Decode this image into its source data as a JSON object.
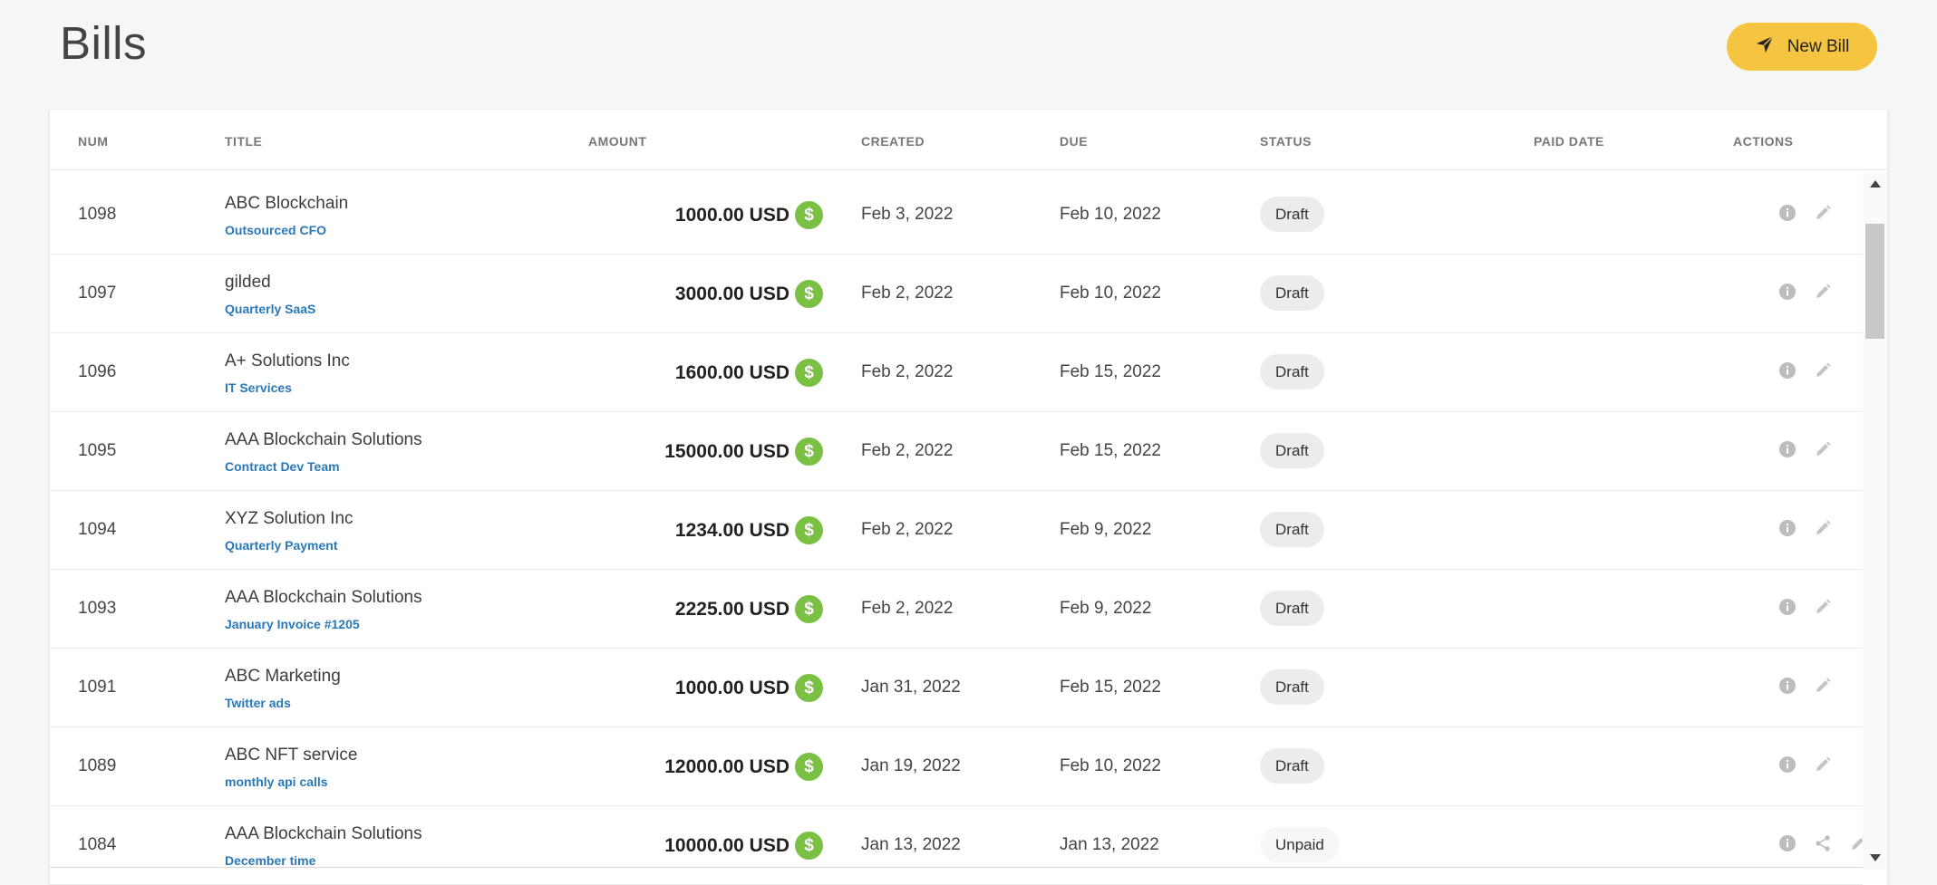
{
  "header": {
    "title": "Bills",
    "new_bill_label": "New Bill"
  },
  "table": {
    "columns": {
      "num": "NUM",
      "title": "TITLE",
      "amount": "AMOUNT",
      "created": "CREATED",
      "due": "DUE",
      "status": "STATUS",
      "paid_date": "PAID DATE",
      "actions": "ACTIONS"
    },
    "rows": [
      {
        "num": "1098",
        "title": "ABC Blockchain",
        "subtitle": "Outsourced CFO",
        "amount": "1000.00 USD",
        "created": "Feb 3, 2022",
        "due": "Feb 10, 2022",
        "status": "Draft",
        "paid_date": ""
      },
      {
        "num": "1097",
        "title": "gilded",
        "subtitle": "Quarterly SaaS",
        "amount": "3000.00 USD",
        "created": "Feb 2, 2022",
        "due": "Feb 10, 2022",
        "status": "Draft",
        "paid_date": ""
      },
      {
        "num": "1096",
        "title": "A+ Solutions Inc",
        "subtitle": "IT Services",
        "amount": "1600.00 USD",
        "created": "Feb 2, 2022",
        "due": "Feb 15, 2022",
        "status": "Draft",
        "paid_date": ""
      },
      {
        "num": "1095",
        "title": "AAA Blockchain Solutions",
        "subtitle": "Contract Dev Team",
        "amount": "15000.00 USD",
        "created": "Feb 2, 2022",
        "due": "Feb 15, 2022",
        "status": "Draft",
        "paid_date": ""
      },
      {
        "num": "1094",
        "title": "XYZ Solution Inc",
        "subtitle": "Quarterly Payment",
        "amount": "1234.00 USD",
        "created": "Feb 2, 2022",
        "due": "Feb 9, 2022",
        "status": "Draft",
        "paid_date": ""
      },
      {
        "num": "1093",
        "title": "AAA Blockchain Solutions",
        "subtitle": "January Invoice #1205",
        "amount": "2225.00 USD",
        "created": "Feb 2, 2022",
        "due": "Feb 9, 2022",
        "status": "Draft",
        "paid_date": ""
      },
      {
        "num": "1091",
        "title": "ABC Marketing",
        "subtitle": "Twitter ads",
        "amount": "1000.00 USD",
        "created": "Jan 31, 2022",
        "due": "Feb 15, 2022",
        "status": "Draft",
        "paid_date": ""
      },
      {
        "num": "1089",
        "title": "ABC NFT service",
        "subtitle": "monthly api calls",
        "amount": "12000.00 USD",
        "created": "Jan 19, 2022",
        "due": "Feb 10, 2022",
        "status": "Draft",
        "paid_date": ""
      },
      {
        "num": "1084",
        "title": "AAA Blockchain Solutions",
        "subtitle": "December time",
        "amount": "10000.00 USD",
        "created": "Jan 13, 2022",
        "due": "Jan 13, 2022",
        "status": "Unpaid",
        "paid_date": ""
      }
    ]
  },
  "icons": {
    "new_bill": "paper-plane-icon",
    "currency": "dollar-coin-icon",
    "info": "info-icon",
    "edit": "pencil-icon",
    "share": "share-icon",
    "currency_symbol": "$"
  },
  "colors": {
    "accent": "#f5c542",
    "currency_badge": "#7ac143",
    "subtitle_link": "#2a78b8"
  }
}
